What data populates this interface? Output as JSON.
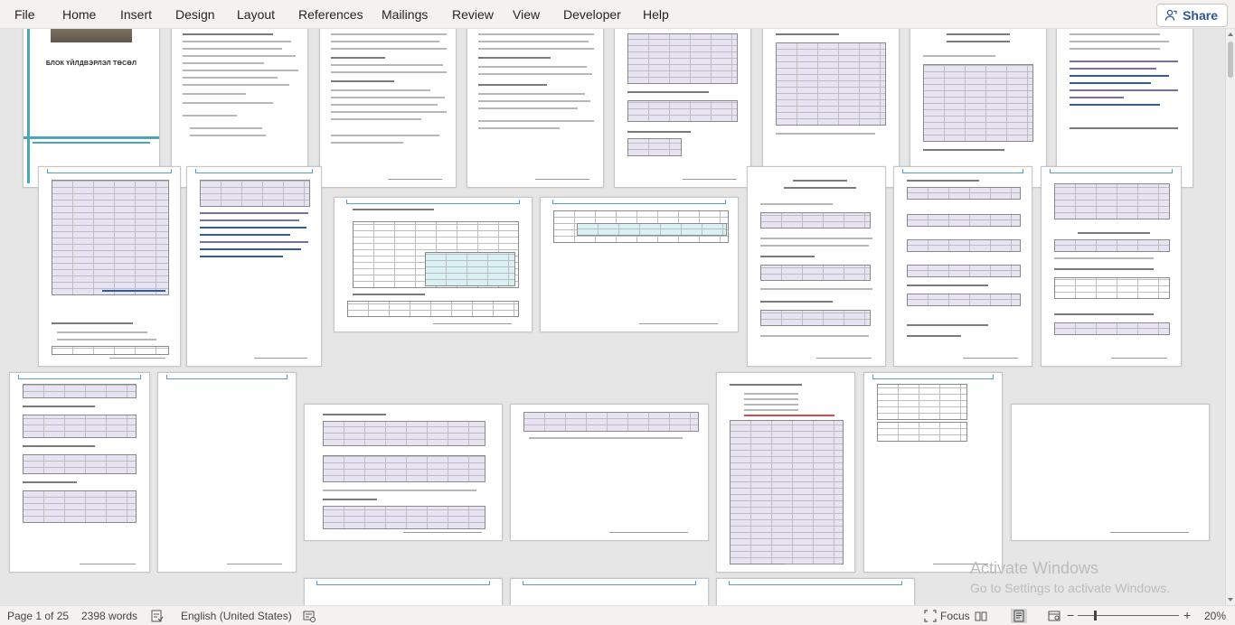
{
  "menu": {
    "file": "File",
    "home": "Home",
    "insert": "Insert",
    "design": "Design",
    "layout": "Layout",
    "references": "References",
    "mailings": "Mailings",
    "review": "Review",
    "view": "View",
    "developer": "Developer",
    "help": "Help",
    "share": "Share"
  },
  "document": {
    "cover_title": "БЛОК ҮЙЛДВЭРЛЭЛ ТӨСӨЛ"
  },
  "watermark": {
    "line1": "Activate Windows",
    "line2": "Go to Settings to activate Windows."
  },
  "status": {
    "page": "Page 1 of 25",
    "words": "2398 words",
    "language": "English (United States)",
    "focus": "Focus",
    "zoom": "20%",
    "zoom_minus": "−",
    "zoom_plus": "+"
  },
  "icons": {
    "share": "share-person-icon",
    "proofing": "proofing-icon",
    "accessibility": "accessibility-icon",
    "focus": "focus-icon",
    "read_mode": "read-mode-icon",
    "print_layout": "print-layout-icon",
    "web_layout": "web-layout-icon"
  },
  "colors": {
    "accent_blue": "#2b579a",
    "table_lavender": "#e7e3f3",
    "table_cyan": "#d9f0f4",
    "header_rule": "#5b9bd5"
  }
}
